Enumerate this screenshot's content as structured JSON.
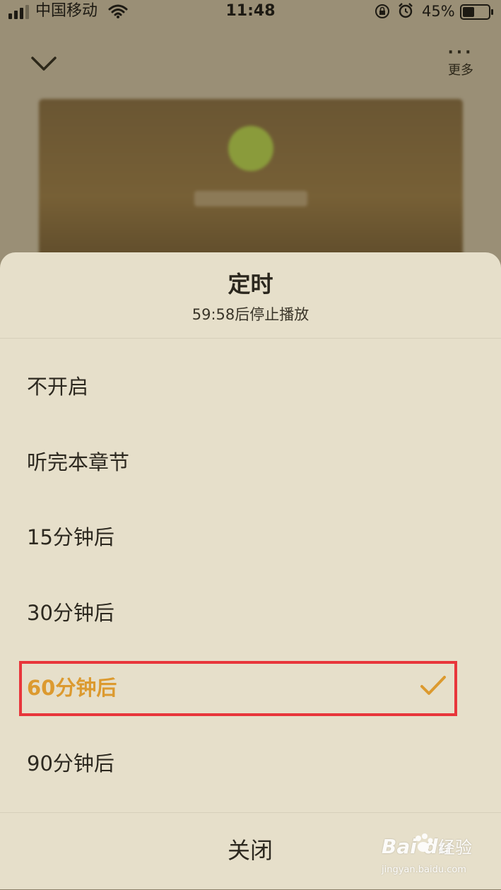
{
  "status_bar": {
    "carrier": "中国移动",
    "time": "11:48",
    "battery_percent": "45%",
    "battery_level": 0.45
  },
  "player": {
    "more_icon": "···",
    "more_label": "更多"
  },
  "sheet": {
    "title": "定时",
    "subtitle": "59:58后停止播放",
    "options": [
      {
        "label": "不开启",
        "selected": false
      },
      {
        "label": "听完本章节",
        "selected": false
      },
      {
        "label": "15分钟后",
        "selected": false
      },
      {
        "label": "30分钟后",
        "selected": false
      },
      {
        "label": "60分钟后",
        "selected": true
      },
      {
        "label": "90分钟后",
        "selected": false
      }
    ],
    "close_label": "关闭"
  },
  "colors": {
    "selected_accent": "#dc9a2f",
    "highlight_border": "#e8363b",
    "sheet_background": "#e6dfca"
  },
  "watermark": {
    "logo_text": "Bai du",
    "name": "经验",
    "site": "jingyan.baidu.com"
  }
}
